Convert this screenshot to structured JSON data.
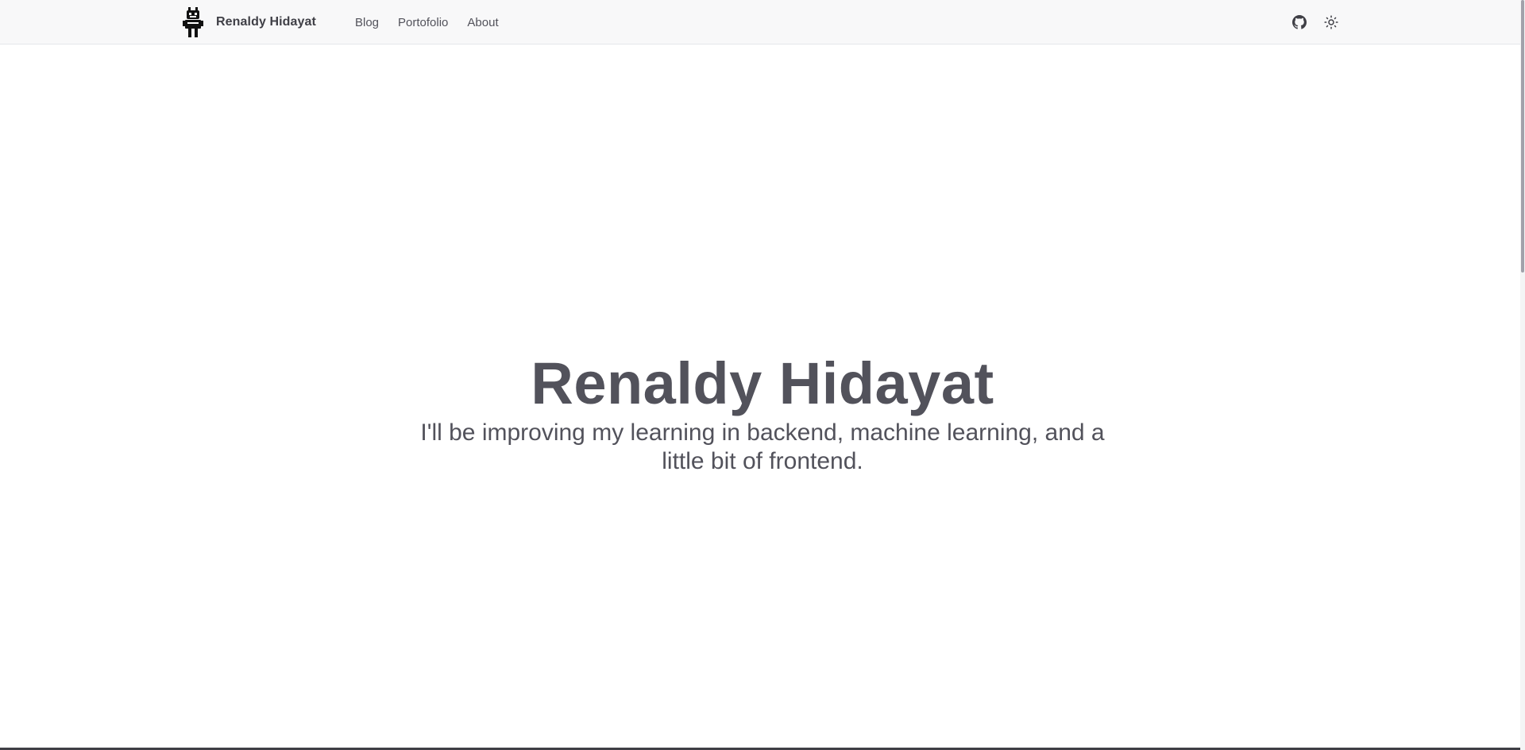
{
  "header": {
    "brand_name": "Renaldy Hidayat",
    "nav": [
      {
        "label": "Blog"
      },
      {
        "label": "Portofolio"
      },
      {
        "label": "About"
      }
    ],
    "icons": {
      "logo": "robot-icon",
      "github": "github-icon",
      "theme": "sun-icon"
    }
  },
  "hero": {
    "title": "Renaldy Hidayat",
    "subtitle": "I'll be improving my learning in backend, machine learning, and a little bit of frontend."
  },
  "colors": {
    "text": "#52525b",
    "header_bg": "#f8f8f9",
    "background": "#ffffff"
  }
}
